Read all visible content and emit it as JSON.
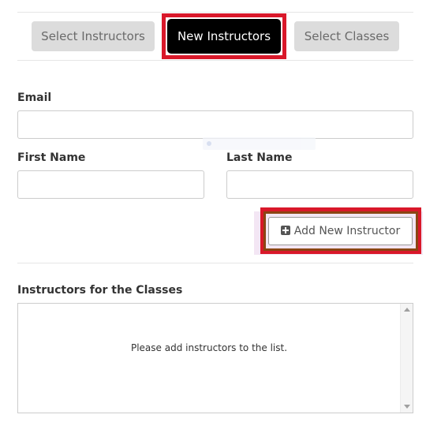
{
  "tabs": {
    "select_instructors": "Select Instructors",
    "new_instructors": "New Instructors",
    "select_classes": "Select Classes"
  },
  "form": {
    "email_label": "Email",
    "email_value": "",
    "first_name_label": "First Name",
    "first_name_value": "",
    "last_name_label": "Last Name",
    "last_name_value": ""
  },
  "actions": {
    "add_instructor_label": "Add New Instructor",
    "add_instructor_icon": "plus-square-icon"
  },
  "instructors_list": {
    "label": "Instructors for the Classes",
    "empty_message": "Please add instructors to the list."
  },
  "colors": {
    "active_tab_bg": "#000000",
    "inactive_tab_bg": "#dcdcdc",
    "highlight_red": "#d9182a"
  }
}
